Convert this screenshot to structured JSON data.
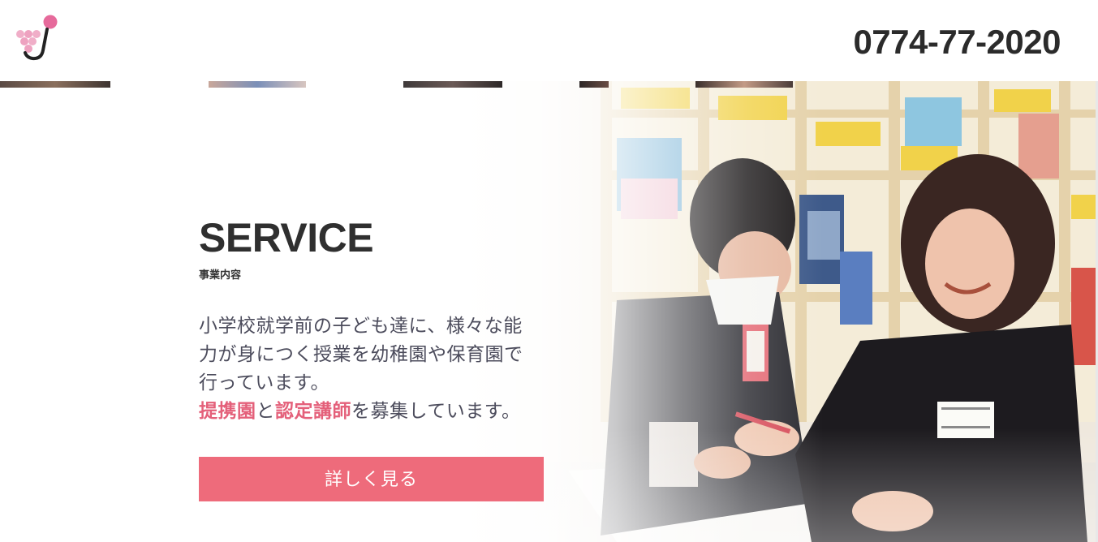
{
  "header": {
    "logo_name": "grape-j-logo",
    "phone": "0774-77-2020"
  },
  "hero": {
    "image_name": "classroom-photo"
  },
  "service": {
    "title": "SERVICE",
    "subtitle": "事業内容",
    "desc_line1": "小学校就学前の子ども達に、様々な能",
    "desc_line2": "力が身につく授業を幼稚園や保育園で",
    "desc_line3": "行っています。",
    "highlight1": "提携園",
    "connector": "と",
    "highlight2": "認定講師",
    "desc_tail": "を募集しています。",
    "button_label": "詳しく見る"
  },
  "colors": {
    "accent": "#ee6b7b",
    "highlight": "#e4607a",
    "logo_pink": "#e66a9b",
    "logo_light": "#f0aec8",
    "text_dark": "#2f2f2f"
  }
}
